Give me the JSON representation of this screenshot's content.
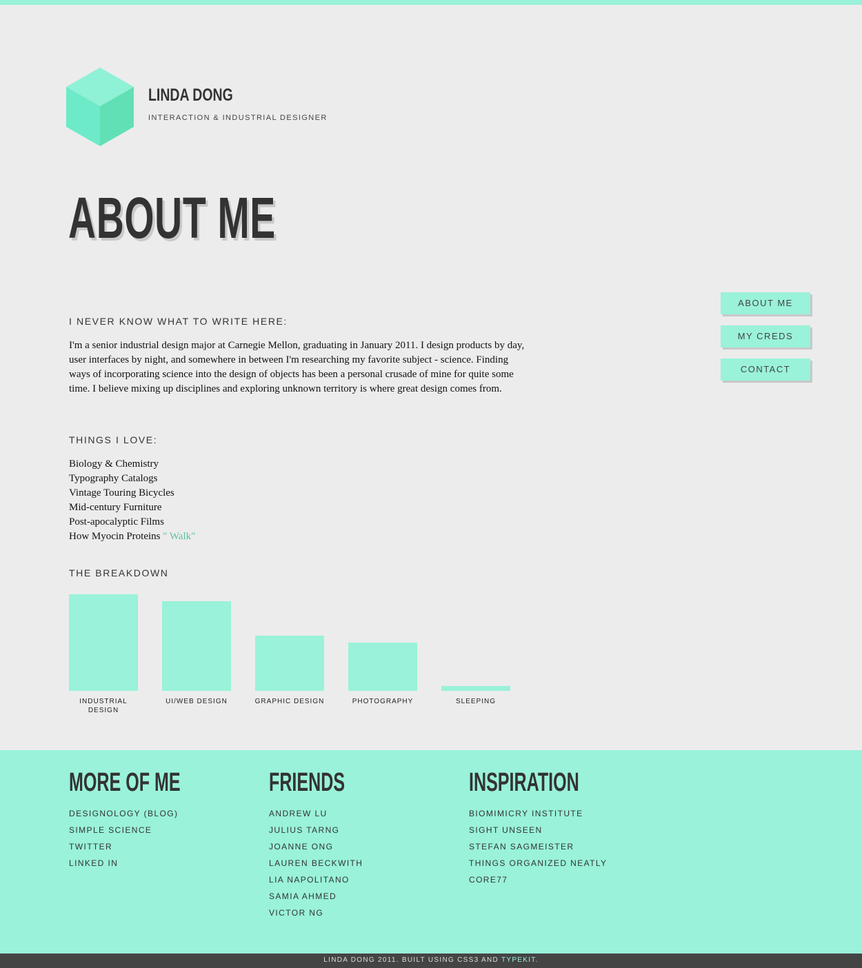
{
  "colors": {
    "accent": "#99f2d9",
    "background": "#ececec",
    "footer_bar": "#444444",
    "link": "#5cbf9d"
  },
  "header": {
    "logo_icon": "cube-icon",
    "name": "LINDA DONG",
    "tagline": "INTERACTION & INDUSTRIAL DESIGNER"
  },
  "page_title": "ABOUT ME",
  "nav": {
    "items": [
      {
        "label": "ABOUT ME"
      },
      {
        "label": "MY CREDS"
      },
      {
        "label": "CONTACT"
      }
    ]
  },
  "about": {
    "heading": "I NEVER KNOW WHAT TO WRITE HERE:",
    "body": "I'm a senior industrial design major at Carnegie Mellon, graduating in January 2011. I design products by day, user interfaces by night, and somewhere in between I'm researching my favorite subject - science. Finding ways of incorporating science into the design of objects has been a personal crusade of mine for quite some time. I believe mixing up disciplines and exploring unknown territory is where great design comes from."
  },
  "loves": {
    "heading": "THINGS I LOVE:",
    "items": [
      "Biology & Chemistry",
      "Typography Catalogs",
      "Vintage Touring Bicycles",
      "Mid-century Furniture",
      "Post-apocalyptic Films",
      "How Myocin Proteins"
    ],
    "last_item_link": "\" Walk\""
  },
  "breakdown": {
    "heading": "THE BREAKDOWN"
  },
  "chart_data": {
    "type": "bar",
    "categories": [
      "INDUSTRIAL DESIGN",
      "UI/WEB DESIGN",
      "GRAPHIC DESIGN",
      "PHOTOGRAPHY",
      "SLEEPING"
    ],
    "values": [
      140,
      130,
      80,
      70,
      7
    ],
    "ylim": [
      0,
      140
    ],
    "grid": false,
    "legend": "none"
  },
  "footer": {
    "columns": [
      {
        "title": "MORE OF ME",
        "links": [
          "DESIGNOLOGY (BLOG)",
          "SIMPLE SCIENCE",
          "TWITTER",
          "LINKED IN"
        ]
      },
      {
        "title": "FRIENDS",
        "links": [
          "ANDREW LU",
          "JULIUS TARNG",
          "JOANNE ONG",
          "LAUREN BECKWITH",
          "LIA NAPOLITANO",
          "SAMIA AHMED",
          "VICTOR NG"
        ]
      },
      {
        "title": "INSPIRATION",
        "links": [
          "BIOMIMICRY INSTITUTE",
          "SIGHT UNSEEN",
          "STEFAN SAGMEISTER",
          "THINGS ORGANIZED NEATLY",
          "CORE77"
        ]
      }
    ]
  },
  "bottom": {
    "text": "LINDA DONG 2011. BUILT USING CSS3 AND",
    "link": "TYPEKIT",
    "suffix": "."
  }
}
